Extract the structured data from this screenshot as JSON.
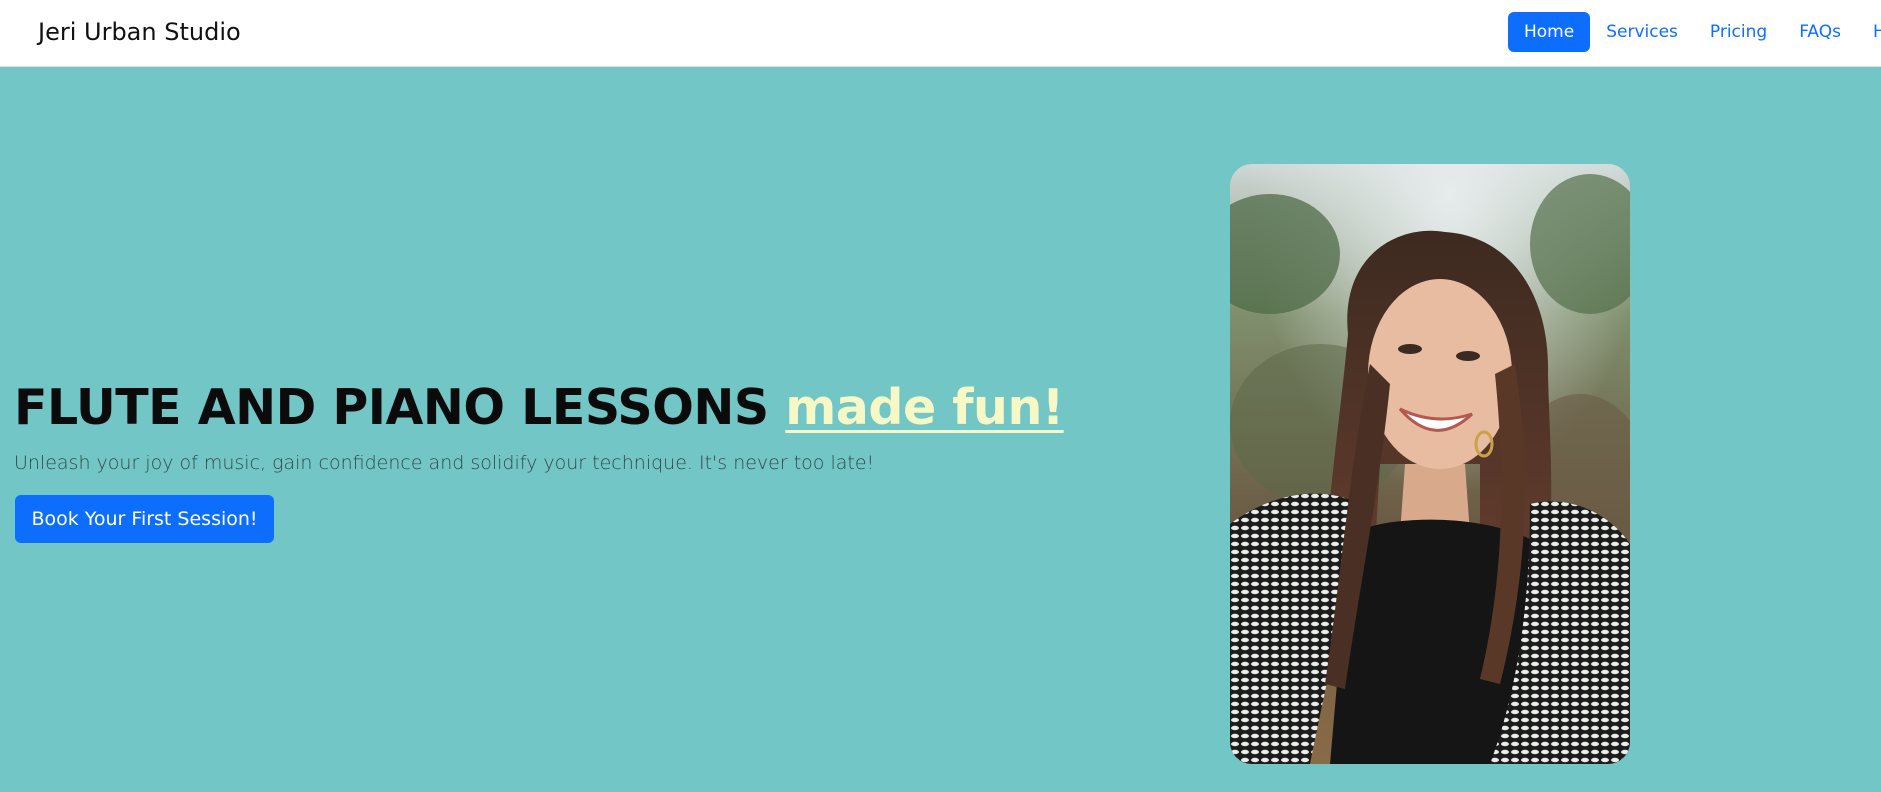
{
  "header": {
    "brand": "Jeri Urban Studio",
    "nav": [
      {
        "label": "Home",
        "active": true
      },
      {
        "label": "Services",
        "active": false
      },
      {
        "label": "Pricing",
        "active": false
      },
      {
        "label": "FAQs",
        "active": false
      },
      {
        "label": "Hours",
        "active": false
      }
    ]
  },
  "hero": {
    "headline_main": "FLUTE AND PIANO LESSONS",
    "headline_accent": "made fun!",
    "subtitle": "Unleash your joy of music, gain confidence and solidify your technique. It's never too late!",
    "cta_label": "Book Your First Session!"
  },
  "colors": {
    "hero_background": "#72c6c5",
    "primary": "#0d6efd",
    "accent_text": "#f6f9c6",
    "navbar_background": "#ffffff"
  }
}
